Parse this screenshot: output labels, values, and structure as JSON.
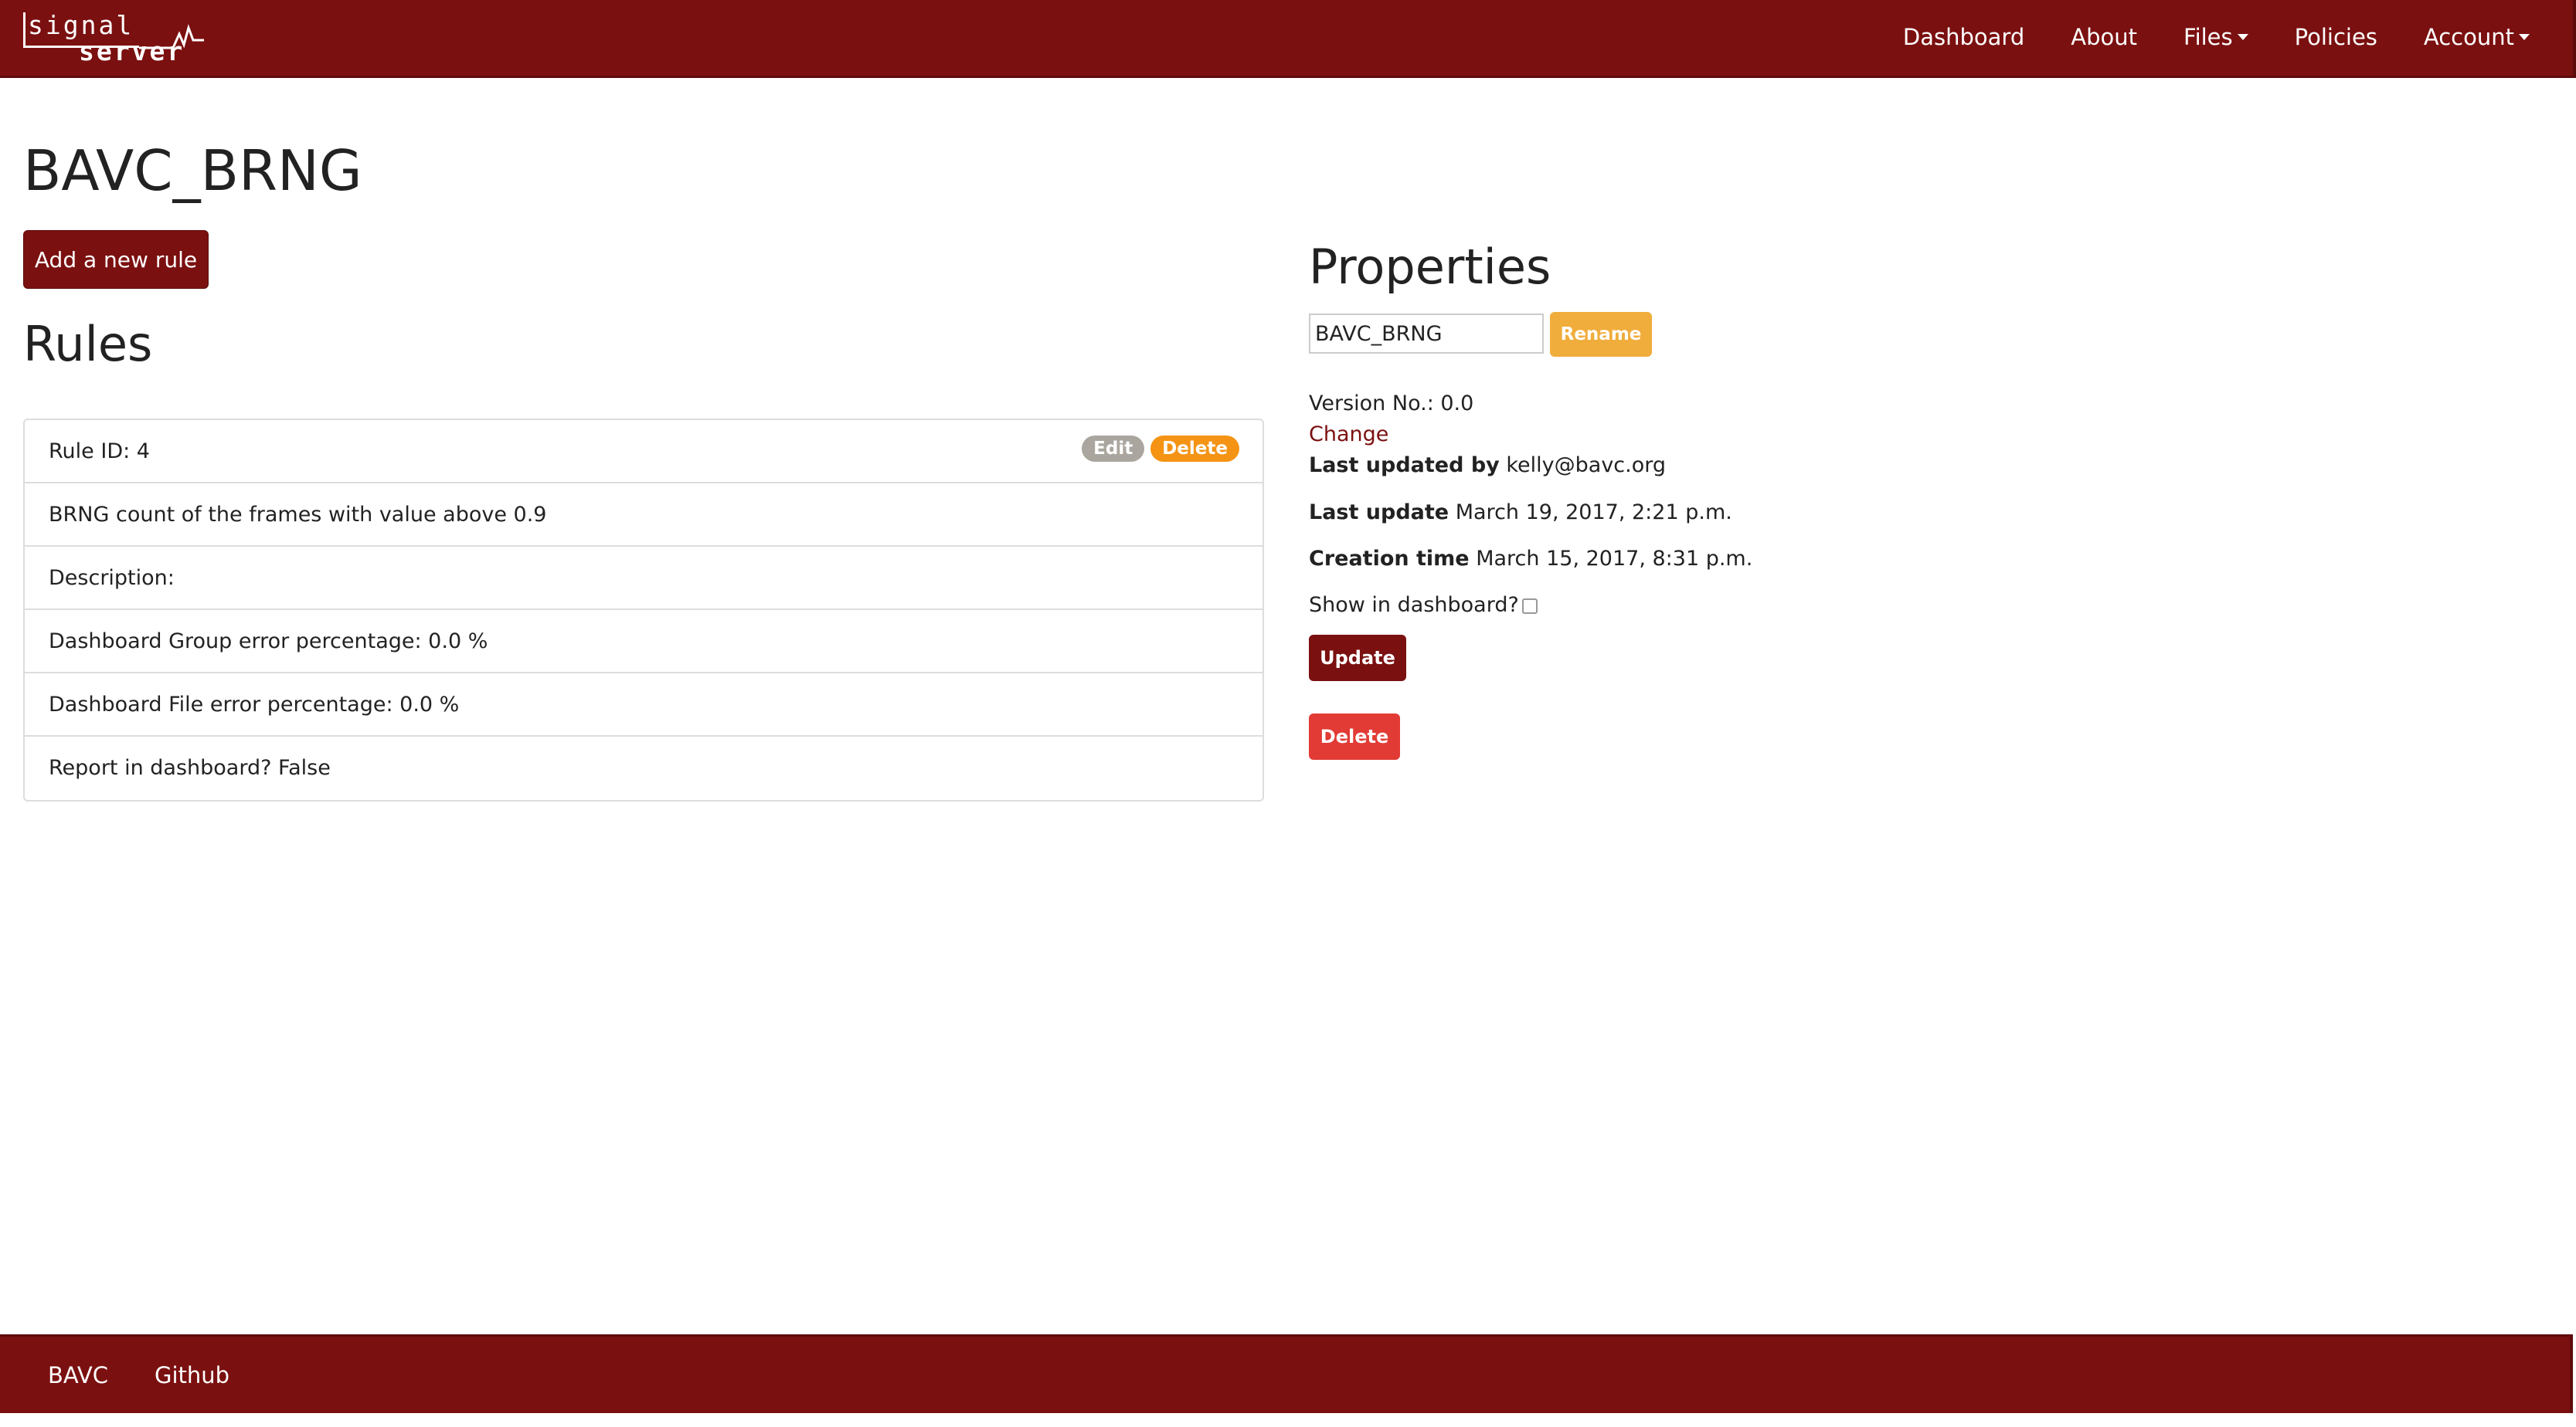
{
  "brand": {
    "line1": "signal",
    "line2": "server"
  },
  "nav": {
    "items": [
      {
        "label": "Dashboard",
        "dropdown": false
      },
      {
        "label": "About",
        "dropdown": false
      },
      {
        "label": "Files",
        "dropdown": true
      },
      {
        "label": "Policies",
        "dropdown": false
      },
      {
        "label": "Account",
        "dropdown": true
      }
    ]
  },
  "page": {
    "title": "BAVC_BRNG",
    "add_rule_label": "Add a new rule"
  },
  "rules": {
    "heading": "Rules",
    "rule": {
      "id_line": "Rule ID: 4",
      "edit_label": "Edit",
      "delete_label": "Delete",
      "summary": "BRNG count of the frames with value above 0.9",
      "description": "Description:",
      "group_error": "Dashboard Group error percentage: 0.0 %",
      "file_error": "Dashboard File error percentage: 0.0 %",
      "report": "Report in dashboard? False"
    }
  },
  "properties": {
    "heading": "Properties",
    "name_value": "BAVC_BRNG",
    "rename_label": "Rename",
    "version": "Version No.: 0.0",
    "change_label": "Change",
    "last_updated_by_label": "Last updated by",
    "last_updated_by_value": "kelly@bavc.org",
    "last_update_label": "Last update",
    "last_update_value": "March 19, 2017, 2:21 p.m.",
    "creation_time_label": "Creation time",
    "creation_time_value": "March 15, 2017, 8:31 p.m.",
    "show_dashboard_label": "Show in dashboard?",
    "show_dashboard_checked": false,
    "update_label": "Update",
    "delete_label": "Delete"
  },
  "footer": {
    "links": [
      "BAVC",
      "Github"
    ]
  },
  "colors": {
    "brand": "#7b1010",
    "rename": "#f0ad3c",
    "delete": "#e23b35",
    "badge_edit": "#aaa69f",
    "badge_delete": "#f59314"
  }
}
